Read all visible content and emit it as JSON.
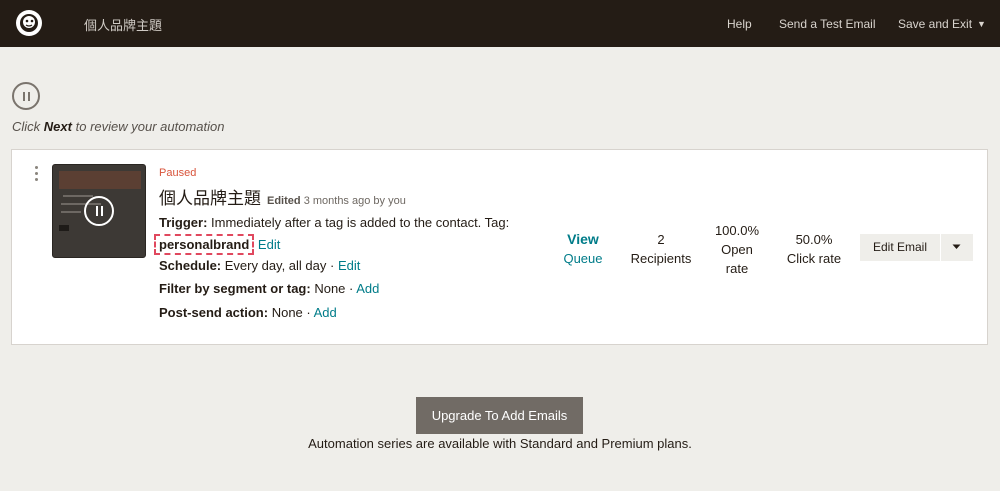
{
  "header": {
    "app_title": "個人品牌主題",
    "help": "Help",
    "send_test": "Send a Test Email",
    "save_exit": "Save and Exit"
  },
  "hint": {
    "prefix": "Click",
    "emph": "Next",
    "suffix": "to review your automation"
  },
  "email": {
    "status": "Paused",
    "title": "個人品牌主題",
    "edited_label": "Edited",
    "edited_ago": "3 months ago by you",
    "trigger_label": "Trigger:",
    "trigger_text": "Immediately after a tag is added to the contact. Tag:",
    "tag": "personalbrand",
    "trigger_edit": "Edit",
    "schedule_label": "Schedule:",
    "schedule_text": "Every day, all day ·",
    "schedule_edit": "Edit",
    "filter_label": "Filter by segment or tag:",
    "filter_text": "None ·",
    "filter_add": "Add",
    "post_label": "Post-send action:",
    "post_text": "None ·",
    "post_add": "Add"
  },
  "stats": {
    "view_queue_1": "View",
    "view_queue_2": "Queue",
    "recipients_num": "2",
    "recipients_label": "Recipients",
    "open_num": "100.0%",
    "open_label_1": "Open",
    "open_label_2": "rate",
    "click_num": "50.0%",
    "click_label": "Click rate"
  },
  "actions": {
    "edit_email": "Edit Email"
  },
  "upgrade": {
    "button": "Upgrade To Add Emails",
    "note": "Automation series are available with Standard and Premium plans."
  }
}
